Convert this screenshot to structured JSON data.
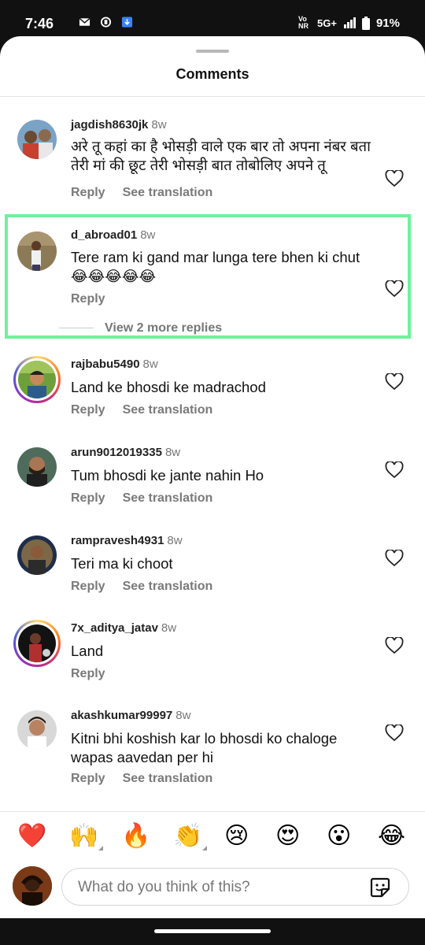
{
  "status_bar": {
    "time": "7:46",
    "network": "5G+",
    "vonr": "Vo NR",
    "battery": "91%"
  },
  "sheet": {
    "title": "Comments"
  },
  "comments": [
    {
      "username": "jagdish8630jk",
      "time": "8w",
      "text": "अरे तू कहां का है भोसड़ी वाले एक बार तो अपना नंबर बता तेरी मां की छूट तेरी भोसड़ी बात तोबोलिए अपने तू",
      "reply_label": "Reply",
      "translation_label": "See translation"
    },
    {
      "username": "d_abroad01",
      "time": "8w",
      "text": "Tere ram ki gand mar lunga tere bhen ki chut 😂😂😂😂😂",
      "reply_label": "Reply",
      "view_replies": "View 2 more replies"
    },
    {
      "username": "rajbabu5490",
      "time": "8w",
      "text": "Land ke bhosdi ke madrachod",
      "reply_label": "Reply",
      "translation_label": "See translation"
    },
    {
      "username": "arun9012019335",
      "time": "8w",
      "text": "Tum bhosdi ke jante nahin Ho",
      "reply_label": "Reply",
      "translation_label": "See translation"
    },
    {
      "username": "rampravesh4931",
      "time": "8w",
      "text": "Teri ma ki choot",
      "reply_label": "Reply",
      "translation_label": "See translation"
    },
    {
      "username": "7x_aditya_jatav",
      "time": "8w",
      "text": "Land",
      "reply_label": "Reply"
    },
    {
      "username": "akashkumar99997",
      "time": "8w",
      "text": "Kitni bhi koshish kar lo bhosdi ko chaloge wapas aavedan per hi",
      "reply_label": "Reply",
      "translation_label": "See translation"
    }
  ],
  "reactions": [
    "❤️",
    "🙌",
    "🔥",
    "👏",
    "😢",
    "😍",
    "😮",
    "😂"
  ],
  "composer": {
    "placeholder": "What do you think of this?"
  },
  "colors": {
    "highlight_border": "#6ef29b",
    "heart_outline": "#222222"
  }
}
